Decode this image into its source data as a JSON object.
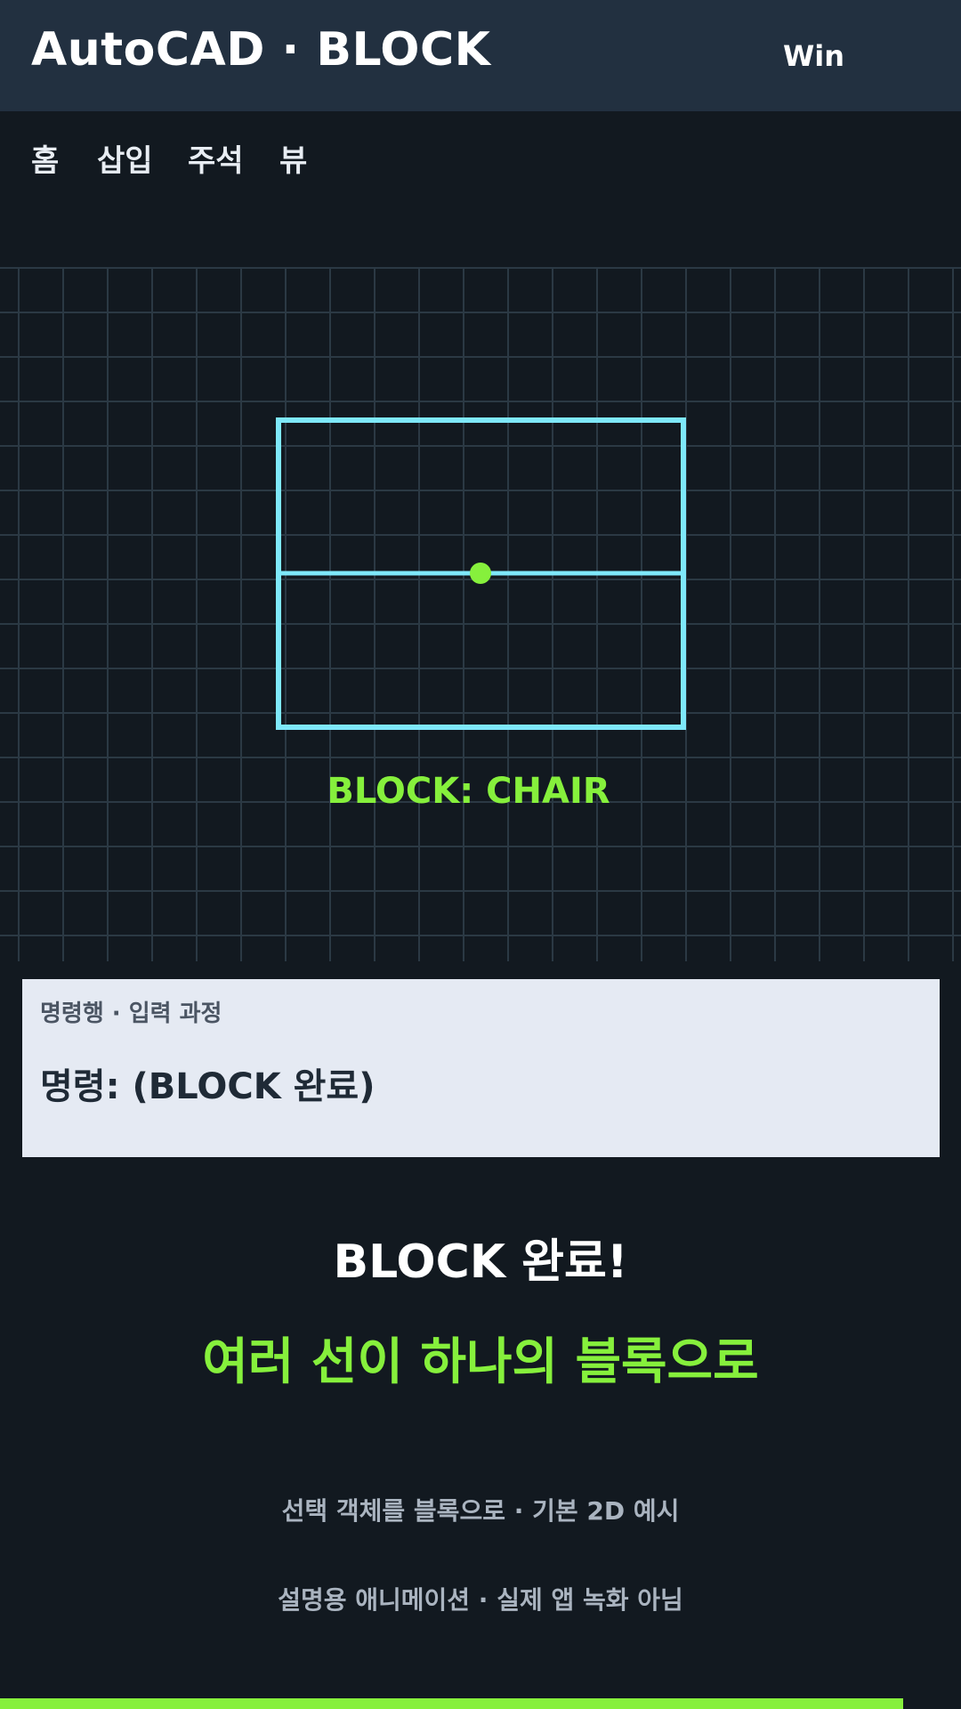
{
  "header": {
    "title": "AutoCAD · BLOCK",
    "platform": "Win"
  },
  "ribbon": {
    "tabs": [
      {
        "label": "홈"
      },
      {
        "label": "삽입"
      },
      {
        "label": "주석"
      },
      {
        "label": "뷰"
      }
    ]
  },
  "canvas": {
    "block_label": "BLOCK: CHAIR",
    "colors": {
      "geometry": "#7ee8fa",
      "base_point": "#86f03c",
      "grid": "#2b3944"
    }
  },
  "command_panel": {
    "caption": "명령행 · 입력 과정",
    "command_text": "명령: (BLOCK 완료)"
  },
  "completion": {
    "title": "BLOCK 완료!",
    "subtitle": "여러 선이 하나의 블록으로"
  },
  "notes": {
    "line1": "선택 객체를 블록으로 · 기본 2D 예시",
    "line2": "설명용 애니메이션 · 실제 앱 녹화 아님"
  },
  "progress": {
    "fraction": 0.94
  },
  "theme": {
    "accent": "#86f03c",
    "header_bg": "#223040",
    "page_bg": "#121920"
  }
}
